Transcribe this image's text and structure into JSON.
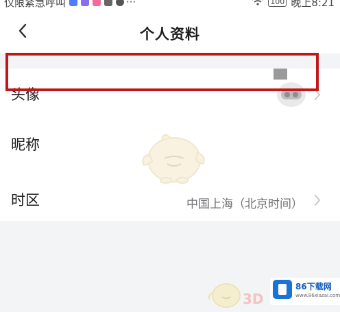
{
  "status_bar": {
    "left_text": "仅限紧急呼叫",
    "more": "···",
    "battery": "100",
    "time": "晚上8:21"
  },
  "header": {
    "title": "个人资料"
  },
  "rows": [
    {
      "label": "头像"
    },
    {
      "label": "昵称"
    },
    {
      "label": "时区",
      "value": "中国上海（北京时间）"
    }
  ],
  "watermark": {
    "mark_3d": "3D",
    "site_name": "86下载网",
    "site_url": "www.86xiazai.com"
  },
  "colors": {
    "highlight_border": "#c01818",
    "page_background": "#f3f4f6",
    "site_logo": "#1a73d6"
  }
}
